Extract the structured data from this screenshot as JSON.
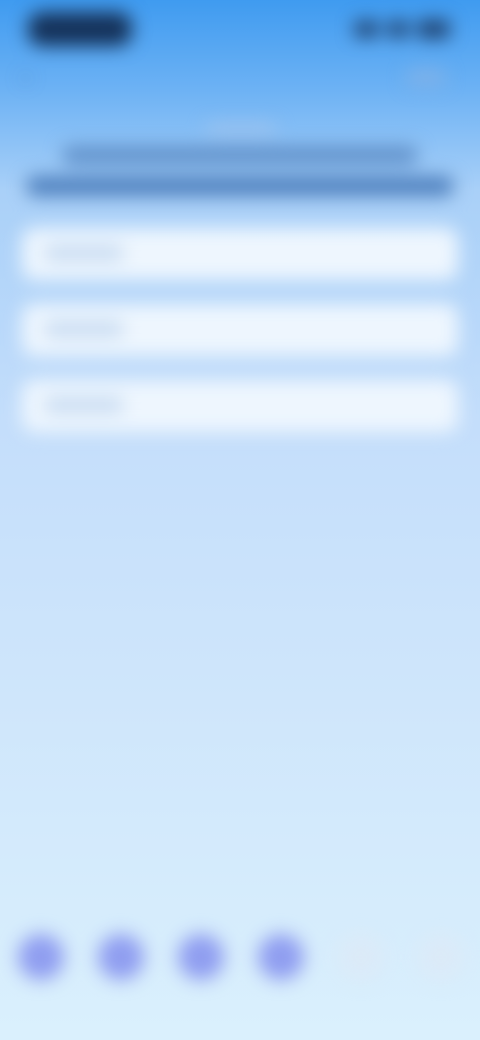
{
  "status_bar": {
    "time": "",
    "icons": [
      "signal-icon",
      "wifi-icon",
      "battery-icon"
    ]
  },
  "nav": {
    "back_icon": "back-arrow-icon",
    "action_label": ""
  },
  "heading": {
    "eyebrow": "",
    "line1": "",
    "line2": ""
  },
  "form": {
    "fields": [
      {
        "label": ""
      },
      {
        "label": ""
      },
      {
        "label": ""
      }
    ]
  },
  "progress_dots": {
    "total": 6,
    "active": 4
  },
  "colors": {
    "gradient_top": "#3f9bf0",
    "gradient_bottom": "#daf0fd",
    "dot_active": "#8f9df0",
    "dot_inactive": "#dbeaf8",
    "card": "#eef6fe"
  }
}
